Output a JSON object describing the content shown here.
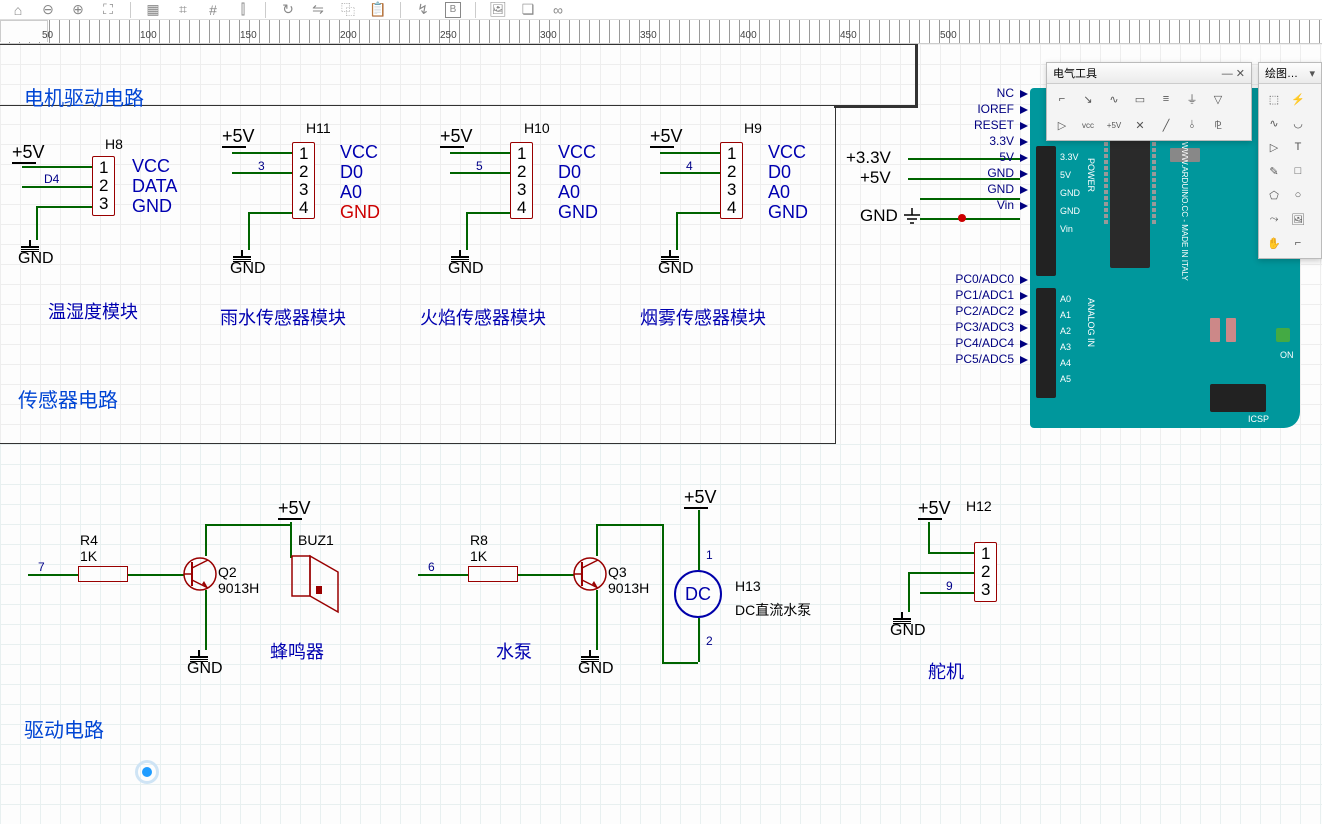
{
  "toolbar_icons": [
    "home",
    "zoom-out",
    "zoom-in",
    "zoom-fit",
    "grid",
    "snap",
    "hash",
    "align",
    "rotate",
    "flip",
    "copy",
    "paste",
    "bold",
    "paste2",
    "layers",
    "share"
  ],
  "ruler_marks": [
    "50",
    "100",
    "150",
    "200",
    "250",
    "300",
    "350",
    "400",
    "450",
    "500"
  ],
  "panels": {
    "electrical": {
      "title": "电气工具",
      "icons": [
        "wire",
        "bus",
        "netlabel",
        "net",
        "junction",
        "power",
        "gnd",
        "bus-entry",
        "vcc",
        "pwr-flag",
        "no-connect",
        "junction2",
        "net-tie",
        "hierarchy"
      ]
    },
    "drawing": {
      "title": "绘图…",
      "icons": [
        "line",
        "arc",
        "curve",
        "circle",
        "pointer",
        "text",
        "pencil",
        "rect",
        "poly",
        "ellipse",
        "bezier",
        "image",
        "hand",
        "corner"
      ]
    }
  },
  "sections": {
    "motor_title": "电机驱动电路",
    "sensor_title": "传感器电路",
    "drive_title": "驱动电路",
    "mod_th": "温湿度模块",
    "mod_rain": "雨水传感器模块",
    "mod_fire": "火焰传感器模块",
    "mod_smoke": "烟雾传感器模块",
    "buzzer": "蜂鸣器",
    "pump": "水泵",
    "servo": "舵机"
  },
  "headers": {
    "h8": {
      "name": "H8",
      "pins": [
        "1",
        "2",
        "3"
      ],
      "labels": [
        "VCC",
        "DATA",
        "GND"
      ]
    },
    "h11": {
      "name": "H11",
      "pins": [
        "1",
        "2",
        "3",
        "4"
      ],
      "labels": [
        "VCC",
        "D0",
        "A0",
        "GND"
      ],
      "gnd_red": true
    },
    "h10": {
      "name": "H10",
      "pins": [
        "1",
        "2",
        "3",
        "4"
      ],
      "labels": [
        "VCC",
        "D0",
        "A0",
        "GND"
      ]
    },
    "h9": {
      "name": "H9",
      "pins": [
        "1",
        "2",
        "3",
        "4"
      ],
      "labels": [
        "VCC",
        "D0",
        "A0",
        "GND"
      ]
    },
    "h12": {
      "name": "H12",
      "pins": [
        "1",
        "2",
        "3"
      ]
    },
    "h13": {
      "name": "H13",
      "label": "DC直流水泵"
    }
  },
  "power": {
    "p5v": "+5V",
    "p33v": "+3.3V",
    "gnd": "GND"
  },
  "components": {
    "r4": {
      "name": "R4",
      "val": "1K"
    },
    "r8": {
      "name": "R8",
      "val": "1K"
    },
    "q2": {
      "name": "Q2",
      "val": "9013H"
    },
    "q3": {
      "name": "Q3",
      "val": "9013H"
    },
    "buz1": "BUZ1",
    "dc": "DC"
  },
  "arduino_left_pins": [
    "NC",
    "IOREF",
    "RESET",
    "3.3V",
    "5V",
    "GND",
    "GND",
    "Vin"
  ],
  "arduino_adc": [
    "PC0/ADC0",
    "PC1/ADC1",
    "PC2/ADC2",
    "PC3/ADC3",
    "PC4/ADC4",
    "PC5/ADC5"
  ],
  "arduino_board_left": [
    "3.3V",
    "5V",
    "GND",
    "GND",
    "Vin"
  ],
  "arduino_board_analog": [
    "A0",
    "A1",
    "A2",
    "A3",
    "A4",
    "A5"
  ],
  "arduino_board_text": {
    "power": "POWER",
    "analog": "ANALOG IN",
    "brand": "WWW.ARDUINO.CC - MADE IN ITALY",
    "on": "ON",
    "icsp": "ICSP"
  },
  "wire_nums": {
    "d4": "D4",
    "n3": "3",
    "n5": "5",
    "n4": "4",
    "n7": "7",
    "n6": "6",
    "n9": "9",
    "m1": "1",
    "m2": "2"
  }
}
